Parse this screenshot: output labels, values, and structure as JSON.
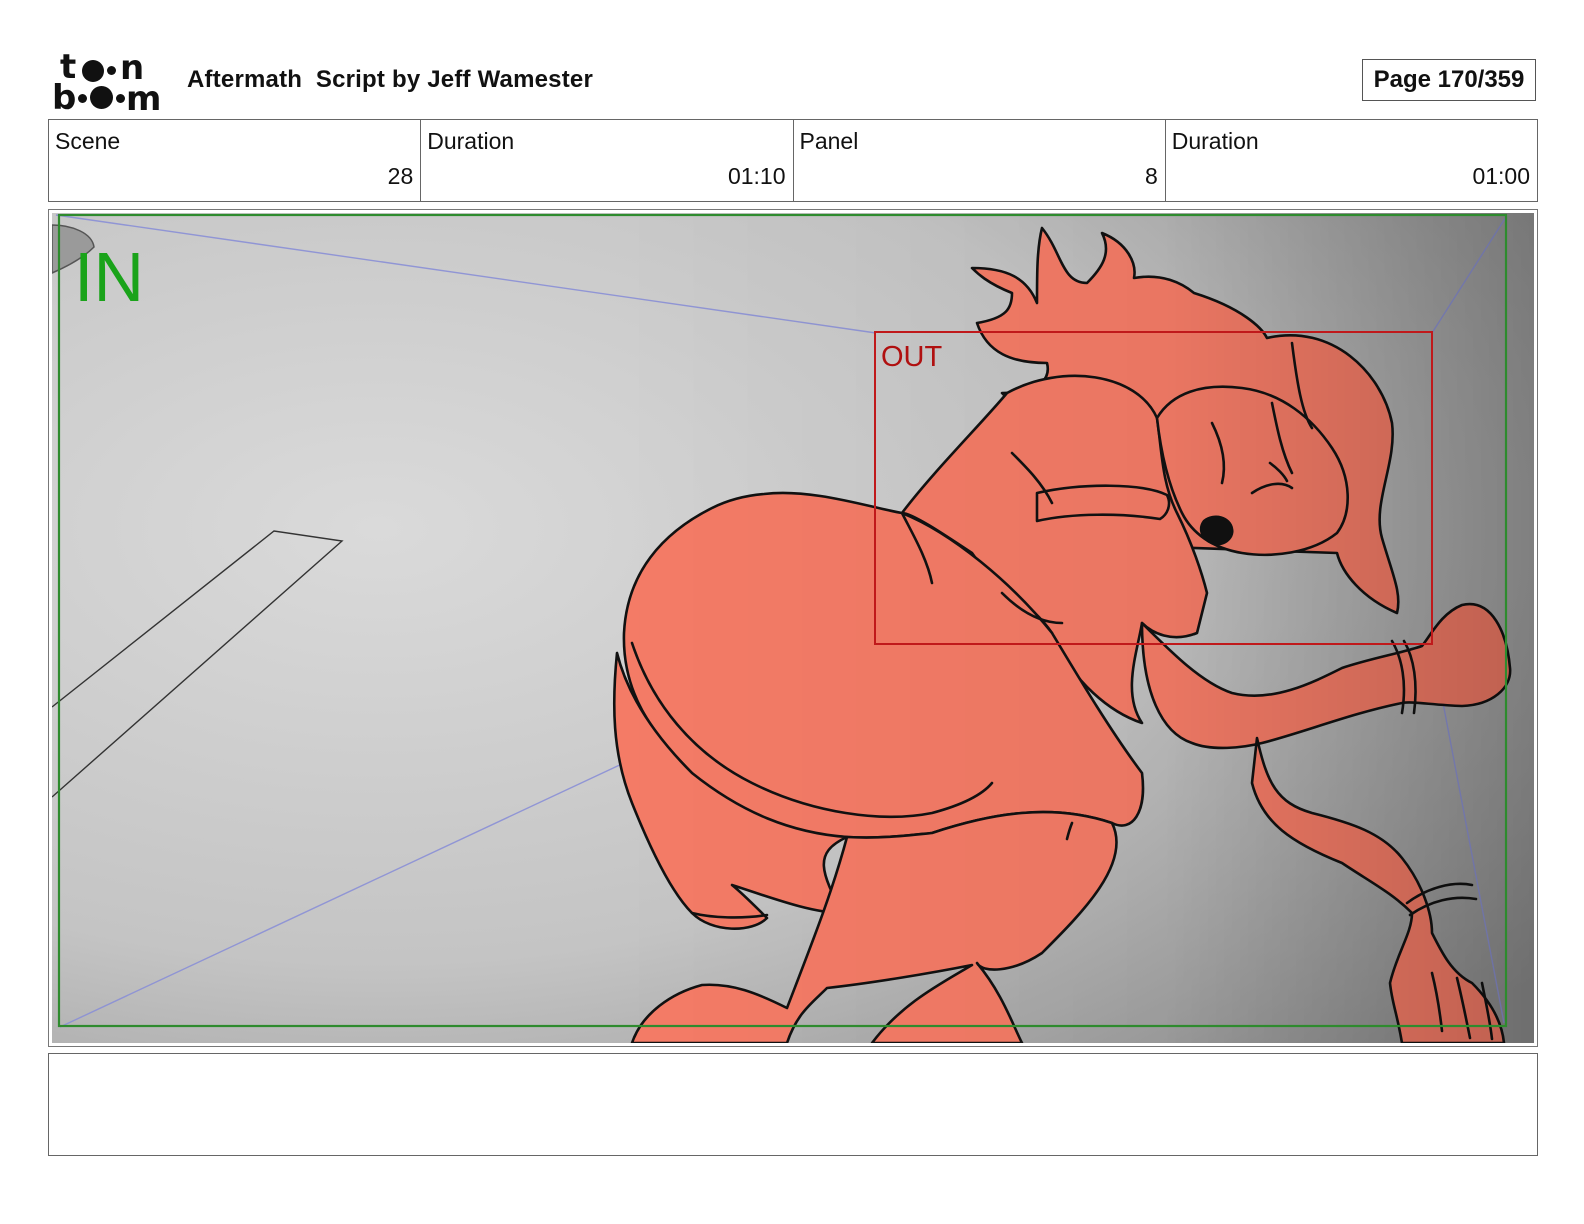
{
  "header": {
    "logo_text": "toonboom",
    "title": "Aftermath  Script by Jeff Wamester",
    "page": "Page 170/359"
  },
  "info": [
    {
      "label": "Scene",
      "value": "28"
    },
    {
      "label": "Duration",
      "value": "01:10"
    },
    {
      "label": "Panel",
      "value": "8"
    },
    {
      "label": "Duration",
      "value": "01:00"
    }
  ],
  "panel": {
    "in_label": "IN",
    "out_label": "OUT",
    "colors": {
      "in_frame": "#2e8b2e",
      "in_text": "#1aa31a",
      "out_frame": "#c0191b",
      "out_text": "#b01010",
      "character_fill": "#f47b66",
      "guide_lines": "#8a8fd6"
    }
  },
  "notes": {
    "text": ""
  }
}
